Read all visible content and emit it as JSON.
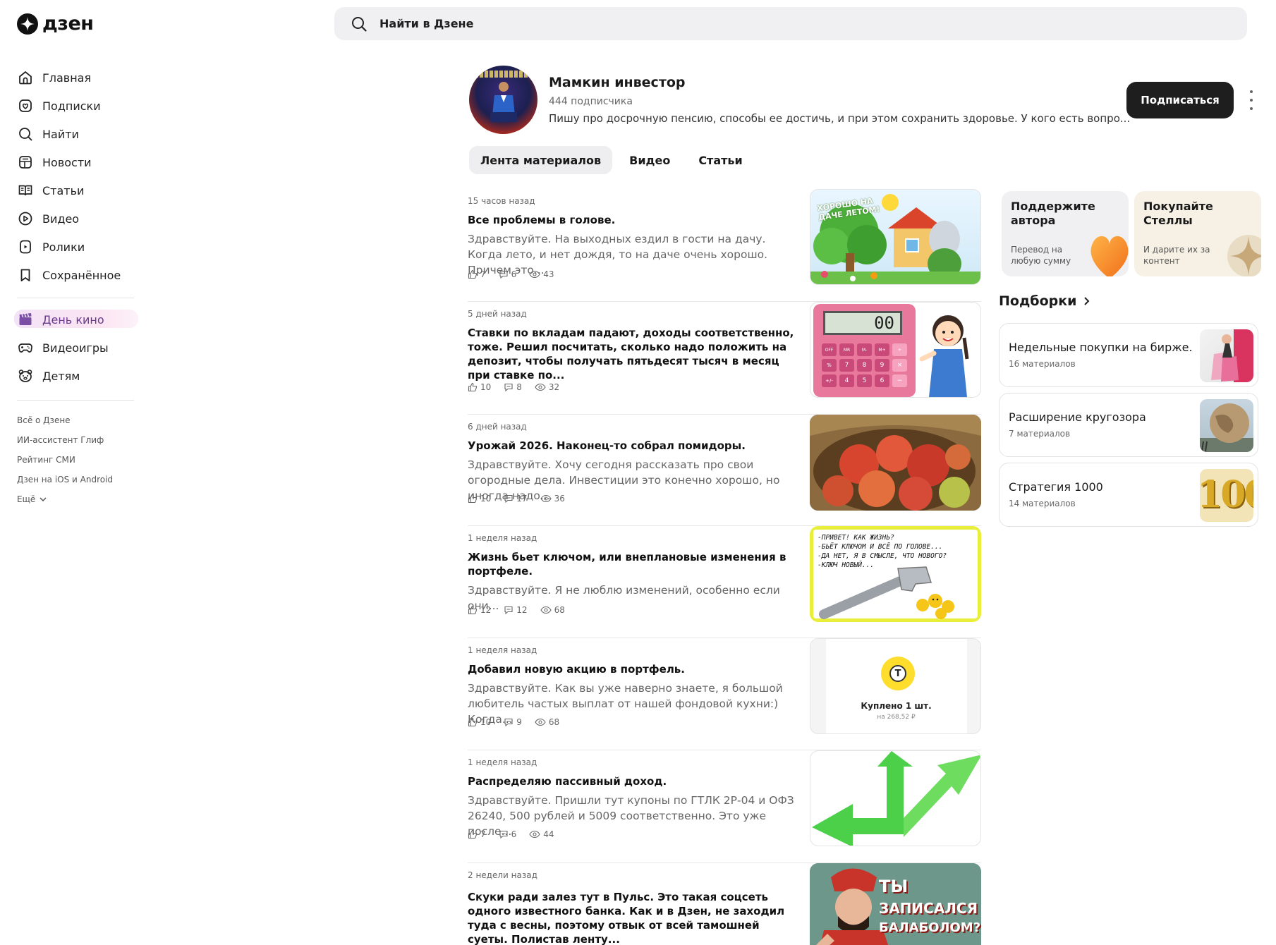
{
  "app": {
    "logo_text": "дзен"
  },
  "search": {
    "placeholder": "Найти в Дзене"
  },
  "sidebar": {
    "items": [
      {
        "label": "Главная",
        "icon": "home-icon"
      },
      {
        "label": "Подписки",
        "icon": "subscriptions-icon"
      },
      {
        "label": "Найти",
        "icon": "search-icon"
      },
      {
        "label": "Новости",
        "icon": "news-icon"
      },
      {
        "label": "Статьи",
        "icon": "articles-icon"
      },
      {
        "label": "Видео",
        "icon": "video-icon"
      },
      {
        "label": "Ролики",
        "icon": "shorts-icon"
      },
      {
        "label": "Сохранённое",
        "icon": "bookmark-icon"
      }
    ],
    "special": [
      {
        "label": "День кино",
        "icon": "clapperboard-icon"
      },
      {
        "label": "Видеоигры",
        "icon": "gamepad-icon"
      },
      {
        "label": "Детям",
        "icon": "kids-icon"
      }
    ],
    "footer": [
      "Всё о Дзене",
      "ИИ-ассистент Глиф",
      "Рейтинг СМИ",
      "Дзен на iOS и Android",
      "Ещё"
    ]
  },
  "channel": {
    "title": "Мамкин инвестор",
    "subscribers": "444 подписчика",
    "description": "Пишу про досрочную пенсию, способы ее достичь, и при этом сохранить здоровье. У кого есть вопро...",
    "subscribe_label": "Подписаться"
  },
  "tabs": [
    {
      "label": "Лента материалов",
      "active": true
    },
    {
      "label": "Видео",
      "active": false
    },
    {
      "label": "Статьи",
      "active": false
    }
  ],
  "feed": [
    {
      "time": "15 часов назад",
      "title": "Все проблемы в голове.",
      "snippet": "Здравствуйте. На выходных ездил в гости на дачу. Когда лето, и нет дождя, то на даче очень хорошо. Причем это...",
      "likes": "7",
      "comments": "6",
      "views": "43"
    },
    {
      "time": "5 дней назад",
      "title": "Ставки по вкладам падают, доходы соответственно, тоже. Решил посчитать, сколько надо положить на депозит, чтобы получать пятьдесят тысяч в месяц при ставке по...",
      "snippet": "",
      "likes": "10",
      "comments": "8",
      "views": "32"
    },
    {
      "time": "6 дней назад",
      "title": "Урожай 2026. Наконец-то собрал помидоры.",
      "snippet": "Здравствуйте. Хочу сегодня рассказать про свои огородные дела. Инвестиции это конечно хорошо, но иногда надо...",
      "likes": "10",
      "comments": "17",
      "views": "36"
    },
    {
      "time": "1 неделя назад",
      "title": "Жизнь бьет ключом, или внеплановые изменения в портфеле.",
      "snippet": "Здравствуйте. Я не люблю изменений, особенно если они...",
      "likes": "12",
      "comments": "12",
      "views": "68"
    },
    {
      "time": "1 неделя назад",
      "title": "Добавил новую акцию в портфель.",
      "snippet": "Здравствуйте. Как вы уже наверно знаете, я большой любитель частых выплат от нашей фондовой кухни:) Когда...",
      "likes": "10",
      "comments": "9",
      "views": "68"
    },
    {
      "time": "1 неделя назад",
      "title": "Распределяю пассивный доход.",
      "snippet": "Здравствуйте. Пришли тут купоны по ГТЛК 2Р-04 и ОФЗ 26240, 500 рублей и 5009 соответственно. Это уже после...",
      "likes": "7",
      "comments": "6",
      "views": "44"
    },
    {
      "time": "2 недели назад",
      "title": "Скуки ради залез тут в Пульс. Это такая соцсеть одного известного банка. Как и в Дзен, не заходил туда с весны, поэтому отвык от всей тамошней суеты. Полистав ленту...",
      "snippet": "",
      "likes": "",
      "comments": "",
      "views": ""
    }
  ],
  "thumbs": {
    "dacha_text": "ХОРОШО НА ДАЧЕ ЛЕТОМ!",
    "calc_display": "00",
    "calc_keys": [
      "OFF",
      "MR",
      "M-",
      "M+",
      "÷",
      "%",
      "7",
      "8",
      "9",
      "×",
      "+/-",
      "4",
      "5",
      "6",
      "−"
    ],
    "comic_lines": [
      "-ПРИВЕТ! КАК ЖИЗНЬ?",
      "-БЬЁТ КЛЮЧОМ И ВСЁ ПО ГОЛОВЕ...",
      "-ДА НЕТ, Я В СМЫСЛЕ, ЧТО НОВОГО?",
      "-КЛЮЧ НОВЫЙ..."
    ],
    "bought_badge": "Т",
    "bought_title": "Куплено 1 шт.",
    "bought_price": "на 268,52 ₽",
    "poster_lines": [
      "ТЫ",
      "ЗАПИСАЛСЯ",
      "БАЛАБОЛОМ?"
    ]
  },
  "promos": [
    {
      "title": "Поддержите автора",
      "subtitle": "Перевод на любую сумму",
      "bg": "#f0f0f2"
    },
    {
      "title": "Покупайте Стеллы",
      "subtitle": "И дарите их за контент",
      "bg": "#f6f1e4"
    }
  ],
  "selections": {
    "heading": "Подборки",
    "items": [
      {
        "title": "Недельные покупки на бирже.",
        "count": "16 материалов"
      },
      {
        "title": "Расширение кругозора",
        "count": "7 материалов"
      },
      {
        "title": "Стратегия 1000",
        "count": "14 материалов"
      }
    ],
    "strategy_thumb_text": "100"
  }
}
